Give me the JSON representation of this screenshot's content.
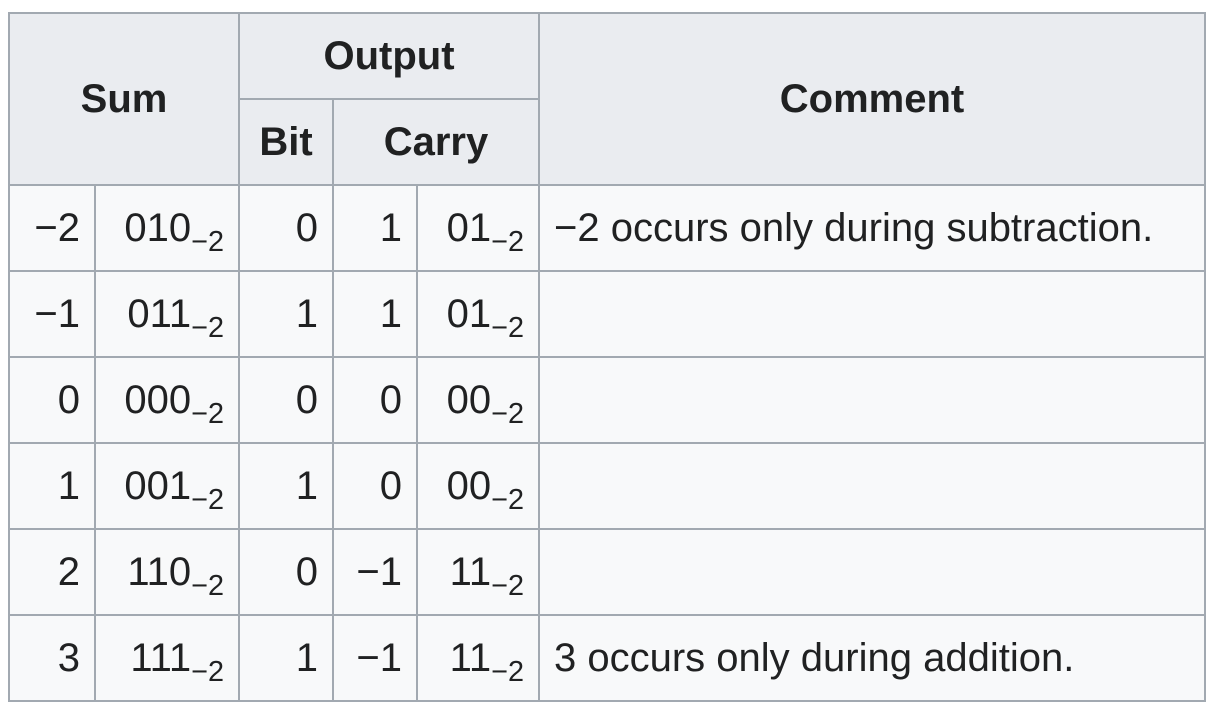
{
  "table": {
    "headers": {
      "sum": "Sum",
      "output": "Output",
      "comment": "Comment",
      "bit": "Bit",
      "carry": "Carry"
    },
    "rows": [
      {
        "sum": "−2",
        "sum_base": "010",
        "base": "−2",
        "bit": "0",
        "carry": "1",
        "carry_base": "01",
        "carry_sub": "−2",
        "comment": "−2 occurs only during subtraction."
      },
      {
        "sum": "−1",
        "sum_base": "011",
        "base": "−2",
        "bit": "1",
        "carry": "1",
        "carry_base": "01",
        "carry_sub": "−2",
        "comment": ""
      },
      {
        "sum": "0",
        "sum_base": "000",
        "base": "−2",
        "bit": "0",
        "carry": "0",
        "carry_base": "00",
        "carry_sub": "−2",
        "comment": ""
      },
      {
        "sum": "1",
        "sum_base": "001",
        "base": "−2",
        "bit": "1",
        "carry": "0",
        "carry_base": "00",
        "carry_sub": "−2",
        "comment": ""
      },
      {
        "sum": "2",
        "sum_base": "110",
        "base": "−2",
        "bit": "0",
        "carry": "−1",
        "carry_base": "11",
        "carry_sub": "−2",
        "comment": ""
      },
      {
        "sum": "3",
        "sum_base": "111",
        "base": "−2",
        "bit": "1",
        "carry": "−1",
        "carry_base": "11",
        "carry_sub": "−2",
        "comment": "3 occurs only during addition."
      }
    ]
  }
}
